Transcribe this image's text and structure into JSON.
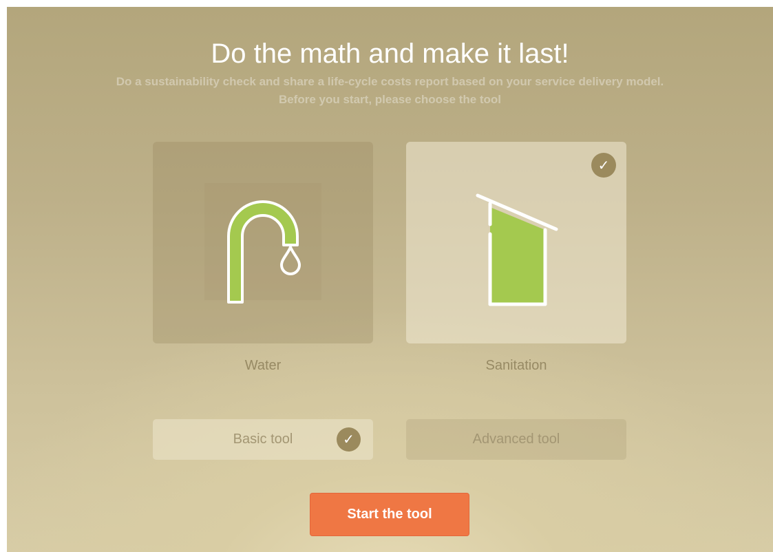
{
  "header": {
    "title": "Do the math and make it last!",
    "subtitle_line1": "Do a sustainability check and share a life-cycle costs report based on your service delivery model.",
    "subtitle_line2": "Before you start, please choose the tool"
  },
  "services": [
    {
      "label": "Water",
      "icon": "water-tap-icon",
      "selected": false
    },
    {
      "label": "Sanitation",
      "icon": "latrine-icon",
      "selected": true
    }
  ],
  "tools": [
    {
      "label": "Basic tool",
      "selected": true
    },
    {
      "label": "Advanced tool",
      "selected": false
    }
  ],
  "check_glyph": "✓",
  "start_button": {
    "label": "Start the tool"
  },
  "colors": {
    "accent_green": "#a4c94f",
    "start_orange": "#ef7744",
    "check_badge": "#9b8a5d"
  }
}
